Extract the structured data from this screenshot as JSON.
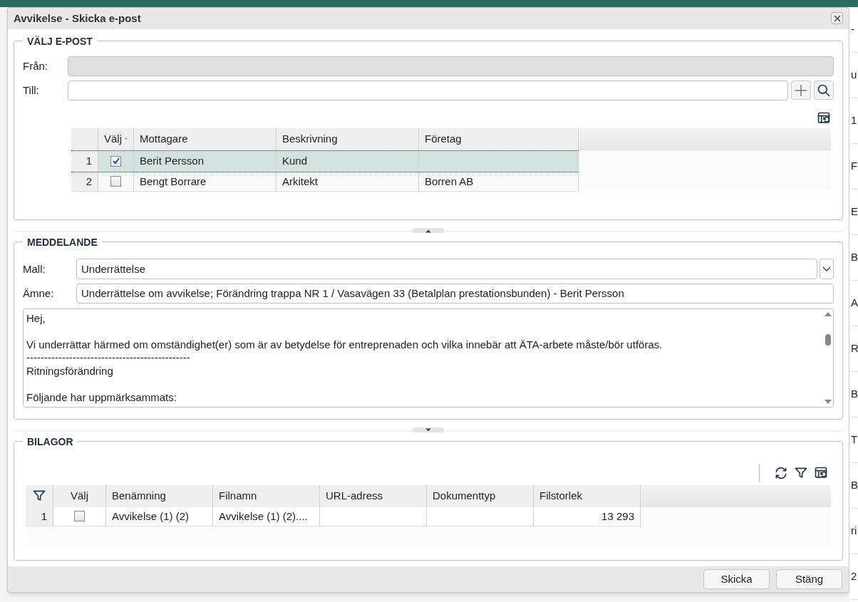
{
  "window": {
    "title": "Avvikelse - Skicka e-post"
  },
  "email_section": {
    "legend": "VÄLJ E-POST",
    "from_label": "Från:",
    "from_disabled": true,
    "to_label": "Till:",
    "recipients": {
      "columns": [
        "",
        "Välj",
        "Mottagare",
        "Beskrivning",
        "Företag"
      ],
      "rows": [
        {
          "number": "1",
          "checked": true,
          "selected": true,
          "recipient": "Berit Persson",
          "description": "Kund",
          "company": ""
        },
        {
          "number": "2",
          "checked": false,
          "selected": false,
          "recipient": "Bengt Borrare",
          "description": "Arkitekt",
          "company": "Borren AB"
        }
      ]
    }
  },
  "message_section": {
    "legend": "MEDDELANDE",
    "template_label": "Mall:",
    "template_value": "Underrättelse",
    "subject_label": "Ämne:",
    "subject_value": "Underrättelse om avvikelse; Förändring trappa NR 1 / Vasavägen 33 (Betalplan prestationsbunden) - Berit Persson",
    "body": "Hej,\n\nVi underrättar härmed om omständighet(er) som är av betydelse för entreprenaden och vilka innebär att ÄTA-arbete måste/bör utföras.\n----------------------------------------------\nRitningsförändring\n\nFöljande har uppmärksammats:"
  },
  "attachments_section": {
    "legend": "BILAGOR",
    "columns": [
      "Välj",
      "Benämning",
      "Filnamn",
      "URL-adress",
      "Dokumenttyp",
      "Filstorlek"
    ],
    "rows": [
      {
        "number": "1",
        "checked": false,
        "name": "Avvikelse (1) (2)",
        "filename": "Avvikelse (1) (2)....",
        "url": "",
        "document_type": "",
        "file_size": "13 293"
      }
    ]
  },
  "buttons": [
    "Skicka",
    "Stäng"
  ],
  "background_edge": [
    "-",
    "u",
    "1",
    "F",
    "E",
    "B",
    "A",
    "R",
    "B",
    "T",
    "B",
    "ri",
    "2"
  ]
}
